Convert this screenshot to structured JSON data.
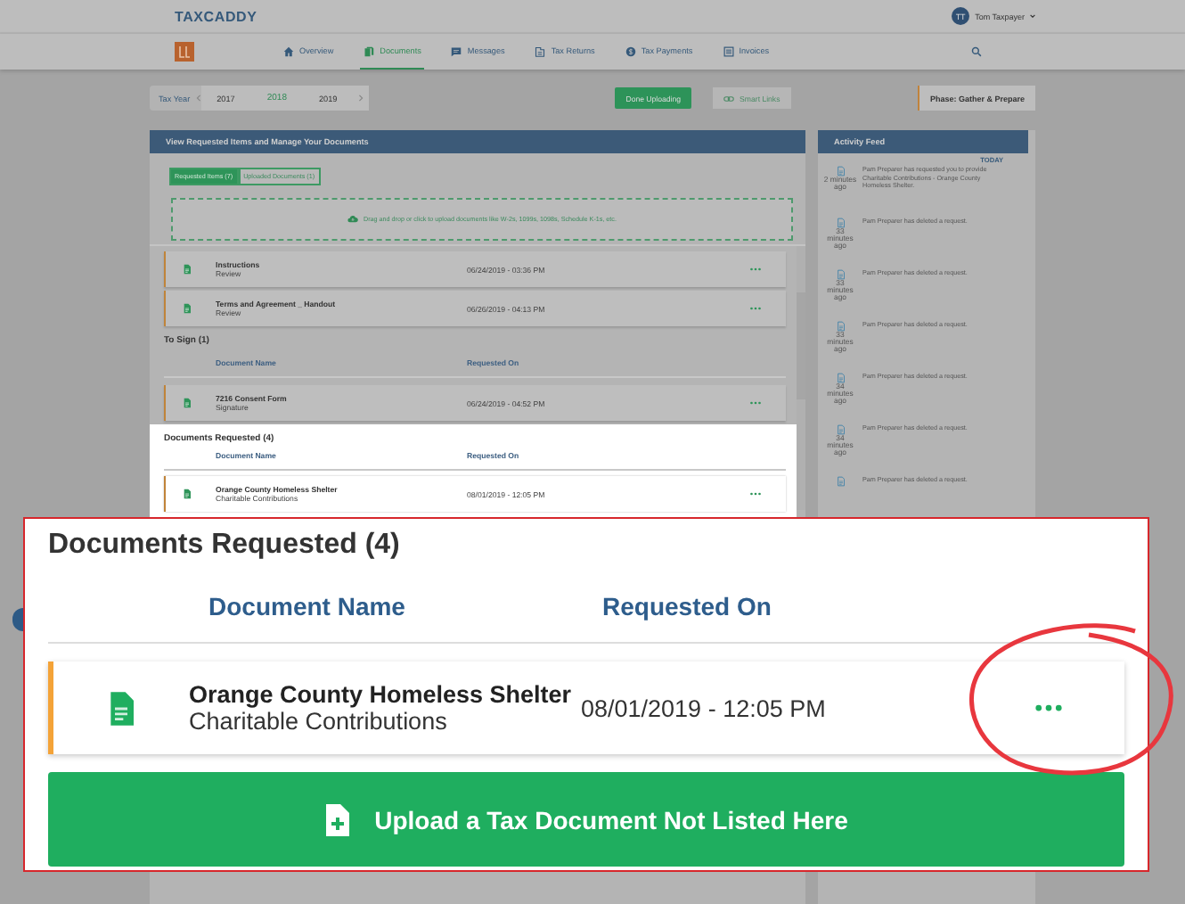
{
  "header": {
    "logo": "TAXCADDY",
    "user": {
      "initials": "TT",
      "name": "Tom Taxpayer"
    }
  },
  "nav": [
    {
      "label": "Overview",
      "selected": false
    },
    {
      "label": "Documents",
      "selected": true
    },
    {
      "label": "Messages",
      "selected": false
    },
    {
      "label": "Tax Returns",
      "selected": false
    },
    {
      "label": "Tax Payments",
      "selected": false
    },
    {
      "label": "Invoices",
      "selected": false
    }
  ],
  "year_selector": {
    "label": "Tax Year",
    "years": [
      {
        "label": "2017",
        "selected": false
      },
      {
        "label": "2018",
        "selected": true
      },
      {
        "label": "2019",
        "selected": false
      }
    ]
  },
  "actions": [
    {
      "label": "Done Uploading",
      "kind": "primary"
    },
    {
      "label": "Smart Links",
      "kind": "link"
    }
  ],
  "phase": "Phase: Gather & Prepare",
  "documents_panel": {
    "title": "View Requested Items and Manage Your Documents",
    "tabs": [
      {
        "label": "Requested Items (7)",
        "selected": true
      },
      {
        "label": "Uploaded Documents (1)",
        "selected": false
      }
    ],
    "dropzone": "Drag and drop or click to upload documents like W-2s, 1099s, 1098s, Schedule K-1s, etc.",
    "sections": [
      {
        "highlighted": false,
        "items": [
          {
            "name": "Instructions",
            "type": "Review",
            "requested_on": "06/24/2019 - 03:36 PM"
          },
          {
            "name": "Terms and Agreement _ Handout",
            "type": "Review",
            "requested_on": "06/26/2019 - 04:13 PM"
          }
        ]
      },
      {
        "title": "To Sign (1)",
        "highlighted": false,
        "columns": [
          "Document Name",
          "Requested On"
        ],
        "items": [
          {
            "name": "7216 Consent Form",
            "type": "Signature",
            "requested_on": "06/24/2019 - 04:52 PM"
          }
        ]
      },
      {
        "title": "Documents Requested (4)",
        "highlighted": true,
        "columns": [
          "Document Name",
          "Requested On"
        ],
        "items": [
          {
            "name": "Orange County Homeless Shelter",
            "type": "Charitable Contributions",
            "requested_on": "08/01/2019 - 12:05 PM"
          }
        ]
      }
    ]
  },
  "activity_feed": {
    "title": "Activity Feed",
    "day": "TODAY",
    "entries": [
      {
        "time": "2 minutes ago",
        "text": "Pam Preparer has requested you to provide Charitable Contributions - Orange County Homeless Shelter."
      },
      {
        "time": "33 minutes ago",
        "text": "Pam Preparer has deleted a request."
      },
      {
        "time": "33 minutes ago",
        "text": "Pam Preparer has deleted a request."
      },
      {
        "time": "33 minutes ago",
        "text": "Pam Preparer has deleted a request."
      },
      {
        "time": "34 minutes ago",
        "text": "Pam Preparer has deleted a request."
      },
      {
        "time": "34 minutes ago",
        "text": "Pam Preparer has deleted a request."
      },
      {
        "text": "Pam Preparer has deleted a request."
      }
    ]
  },
  "callout": {
    "title": "Documents Requested (4)",
    "columns": [
      "Document Name",
      "Requested On"
    ],
    "items": [
      {
        "name": "Orange County Homeless Shelter",
        "type": "Charitable Contributions",
        "requested_on": "08/01/2019 - 12:05 PM"
      }
    ],
    "upload_button": "Upload a Tax Document Not Listed Here"
  }
}
